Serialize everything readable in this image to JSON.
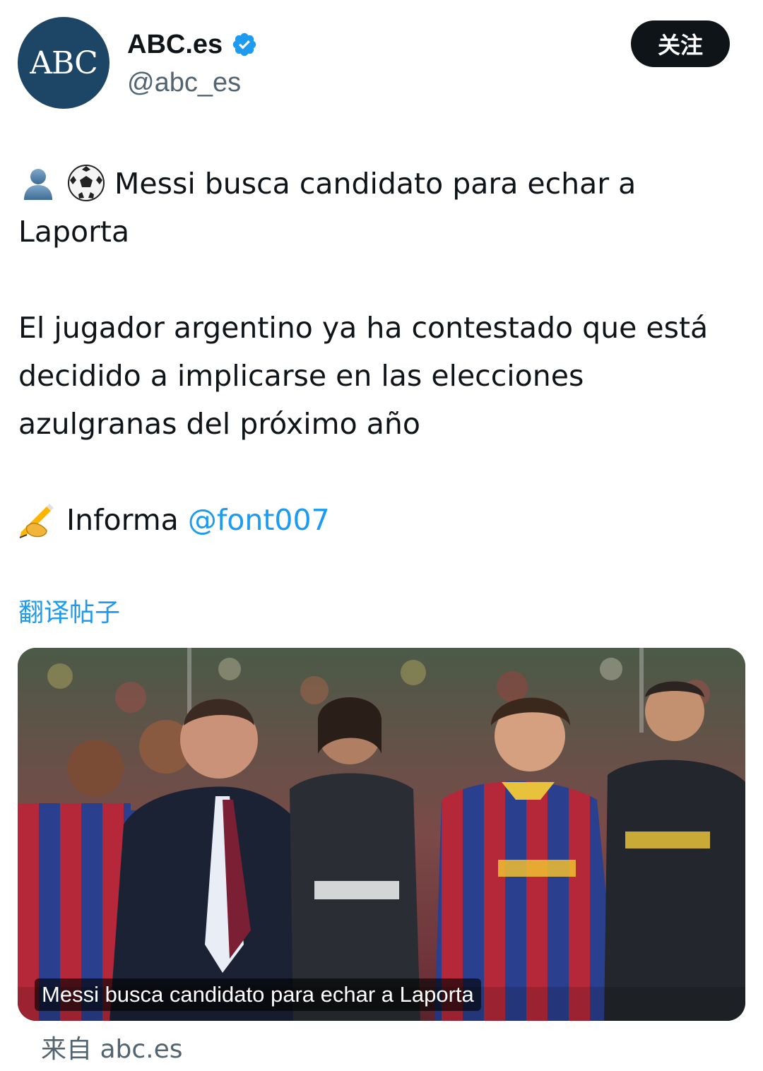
{
  "account": {
    "avatar_text": "ABC",
    "display_name": "ABC.es",
    "handle": "@abc_es",
    "verified": true
  },
  "follow_button": {
    "label": "关注"
  },
  "tweet": {
    "line1_emojis": [
      "bust-in-silhouette",
      "soccer-ball"
    ],
    "headline": "Messi busca candidato para echar a Laporta",
    "paragraph": "El jugador argentino ya ha contestado que está decidido a implicarse en las elecciones azulgranas del próximo año",
    "credit_emoji": "writing-hand",
    "credit_prefix": "Informa",
    "mention": "@font007"
  },
  "translate_link": "翻译帖子",
  "link_card": {
    "caption": "Messi busca candidato para echar a Laporta",
    "source": "来自 abc.es"
  },
  "colors": {
    "accent": "#1d9bf0",
    "avatar_bg": "#1d4565",
    "text": "#0f1419",
    "muted": "#536471",
    "button_bg": "#0f1419"
  }
}
